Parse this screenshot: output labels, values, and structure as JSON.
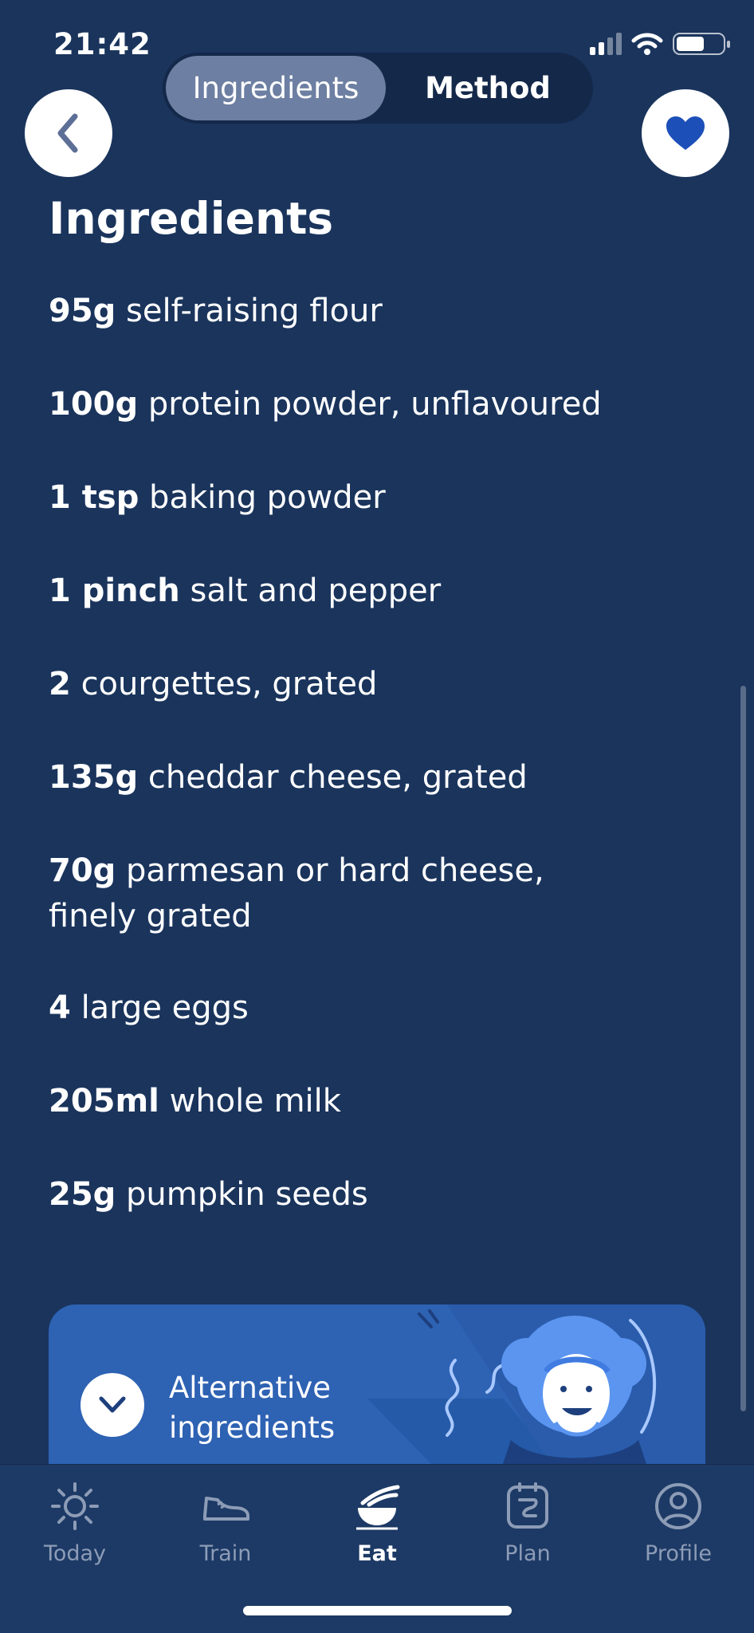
{
  "status_bar": {
    "time": "21:42",
    "battery_level": 0.6
  },
  "header": {
    "tabs": [
      {
        "label": "Ingredients",
        "selected": true
      },
      {
        "label": "Method",
        "selected": false
      }
    ],
    "back_icon": "chevron-left-icon",
    "favorite_icon": "heart-icon"
  },
  "section_title": "Ingredients",
  "ingredients": [
    {
      "qty": "95g",
      "text": "self-raising flour"
    },
    {
      "qty": "100g",
      "text": "protein powder, unflavoured"
    },
    {
      "qty": "1 tsp",
      "text": "baking powder"
    },
    {
      "qty": "1 pinch",
      "text": "salt and pepper"
    },
    {
      "qty": "2",
      "text": "courgettes, grated"
    },
    {
      "qty": "135g",
      "text": "cheddar cheese, grated"
    },
    {
      "qty": "70g",
      "text": "parmesan or hard cheese, finely grated"
    },
    {
      "qty": "4",
      "text": "large eggs"
    },
    {
      "qty": "205ml",
      "text": "whole milk"
    },
    {
      "qty": "25g",
      "text": "pumpkin seeds"
    }
  ],
  "alternative": {
    "label": "Alternative ingredients",
    "icon": "chevron-down-icon"
  },
  "tab_bar": {
    "items": [
      {
        "label": "Today",
        "icon": "sun-icon",
        "active": false
      },
      {
        "label": "Train",
        "icon": "sneaker-icon",
        "active": false
      },
      {
        "label": "Eat",
        "icon": "bowl-icon",
        "active": true
      },
      {
        "label": "Plan",
        "icon": "calendar-icon",
        "active": false
      },
      {
        "label": "Profile",
        "icon": "user-icon",
        "active": false
      }
    ]
  },
  "colors": {
    "background": "#1a345c",
    "card": "#2e62b3",
    "accent": "#1c4fb8",
    "tab_inactive": "#8d9cb6"
  }
}
